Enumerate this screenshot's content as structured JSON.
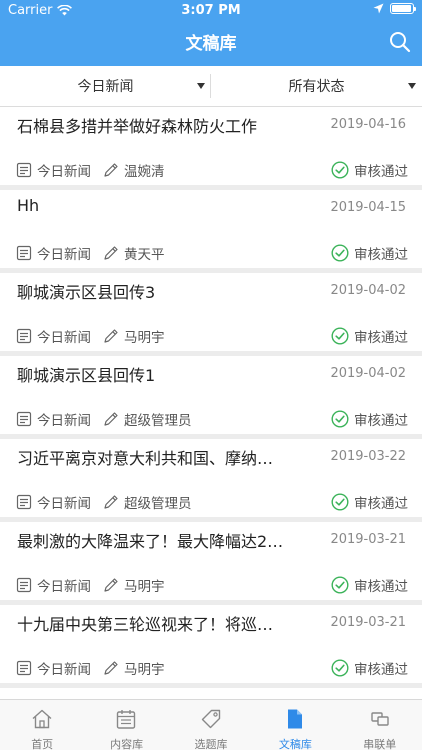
{
  "status_bar": {
    "carrier": "Carrier",
    "time": "3:07 PM"
  },
  "header": {
    "title": "文稿库"
  },
  "filters": {
    "category": "今日新闻",
    "status": "所有状态"
  },
  "articles": [
    {
      "title": "石棉县多措并举做好森林防火工作",
      "date": "2019-04-16",
      "category": "今日新闻",
      "author": "温婉清",
      "status": "审核通过"
    },
    {
      "title": "Hh",
      "date": "2019-04-15",
      "category": "今日新闻",
      "author": "黄天平",
      "status": "审核通过"
    },
    {
      "title": "聊城演示区县回传3",
      "date": "2019-04-02",
      "category": "今日新闻",
      "author": "马明宇",
      "status": "审核通过"
    },
    {
      "title": "聊城演示区县回传1",
      "date": "2019-04-02",
      "category": "今日新闻",
      "author": "超级管理员",
      "status": "审核通过"
    },
    {
      "title": "习近平离京对意大利共和国、摩纳…",
      "date": "2019-03-22",
      "category": "今日新闻",
      "author": "超级管理员",
      "status": "审核通过"
    },
    {
      "title": "最刺激的大降温来了！最大降幅达2…",
      "date": "2019-03-21",
      "category": "今日新闻",
      "author": "马明宇",
      "status": "审核通过"
    },
    {
      "title": "十九届中央第三轮巡视来了！将巡…",
      "date": "2019-03-21",
      "category": "今日新闻",
      "author": "马明宇",
      "status": "审核通过"
    }
  ],
  "tabs": [
    {
      "label": "首页",
      "icon": "home-icon"
    },
    {
      "label": "内容库",
      "icon": "calendar-icon"
    },
    {
      "label": "选题库",
      "icon": "tag-icon"
    },
    {
      "label": "文稿库",
      "icon": "document-icon",
      "active": true
    },
    {
      "label": "串联单",
      "icon": "link-icon"
    }
  ],
  "colors": {
    "accent": "#4aa3f0",
    "active_tab": "#2f8ae8",
    "approved": "#3cb35a"
  }
}
